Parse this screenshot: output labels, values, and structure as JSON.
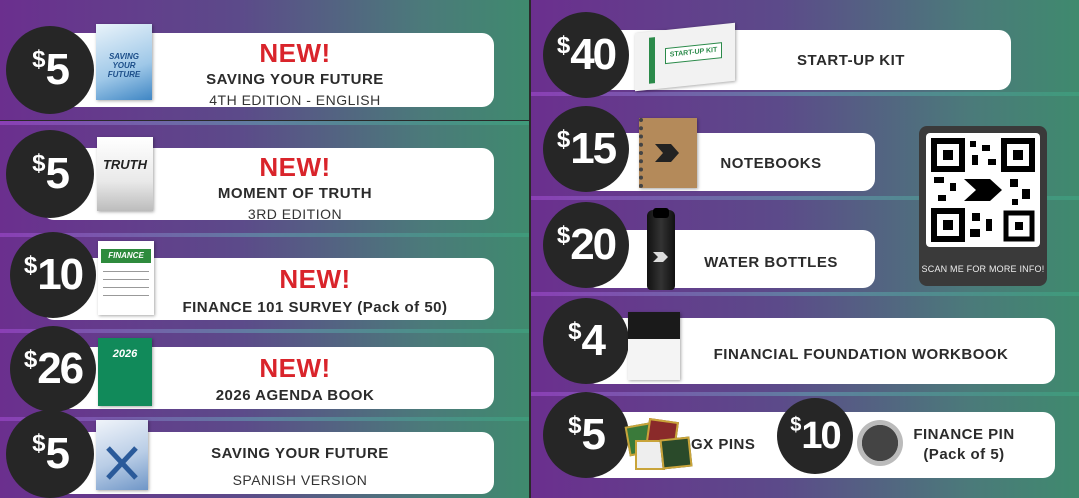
{
  "left_items": [
    {
      "dollar": "$",
      "amount": "5",
      "badge": "NEW!",
      "title": "SAVING YOUR FUTURE",
      "subtitle": "4TH EDITION - ENGLISH",
      "cover_text": "SAVING YOUR FUTURE"
    },
    {
      "dollar": "$",
      "amount": "5",
      "badge": "NEW!",
      "title": "MOMENT OF TRUTH",
      "subtitle": "3RD EDITION",
      "cover_text": "TRUTH"
    },
    {
      "dollar": "$",
      "amount": "10",
      "badge": "NEW!",
      "title": "FINANCE 101 SURVEY (Pack of 50)",
      "cover_text": "FINANCE 101"
    },
    {
      "dollar": "$",
      "amount": "26",
      "badge": "NEW!",
      "title": "2026 AGENDA BOOK",
      "cover_text": "2026"
    },
    {
      "dollar": "$",
      "amount": "5",
      "title": "SAVING YOUR FUTURE",
      "subtitle": "SPANISH VERSION"
    }
  ],
  "right_items": [
    {
      "dollar": "$",
      "amount": "40",
      "title": "START-UP KIT",
      "box_text": "START-UP KIT"
    },
    {
      "dollar": "$",
      "amount": "15",
      "title": "NOTEBOOKS"
    },
    {
      "dollar": "$",
      "amount": "20",
      "title": "WATER BOTTLES"
    },
    {
      "dollar": "$",
      "amount": "4",
      "title": "FINANCIAL FOUNDATION WORKBOOK"
    }
  ],
  "pins": {
    "gx": {
      "dollar": "$",
      "amount": "5",
      "title": "GX PINS"
    },
    "finance": {
      "dollar": "$",
      "amount": "10",
      "title": "FINANCE PIN",
      "subtitle": "(Pack of 5)"
    }
  },
  "qr": {
    "caption": "SCAN ME FOR MORE INFO!"
  }
}
